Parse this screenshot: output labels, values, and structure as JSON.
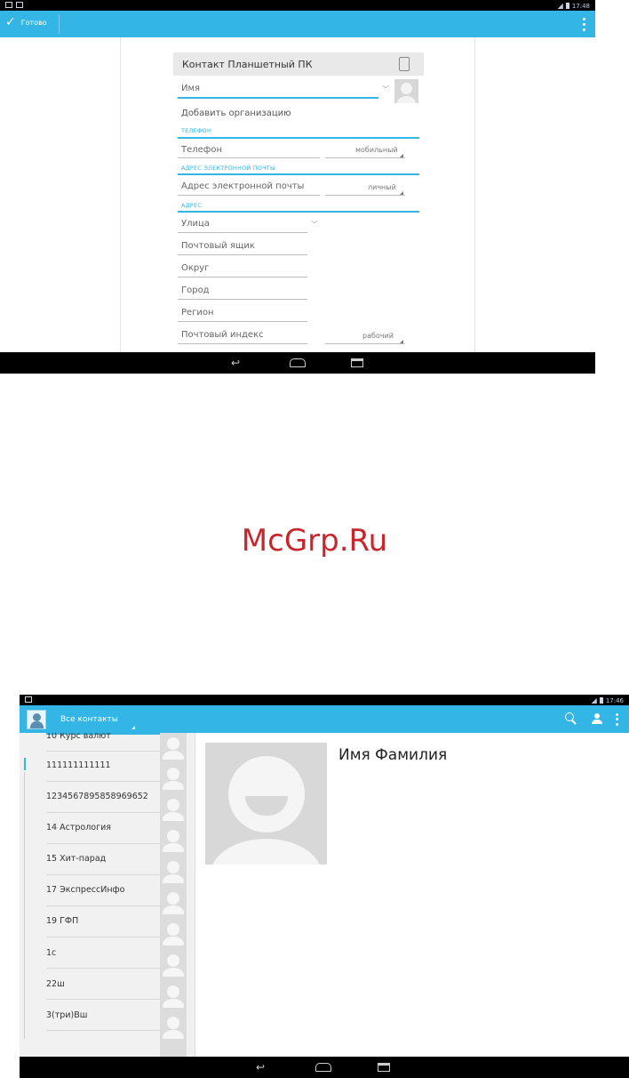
{
  "screen1": {
    "status_time": "17:48",
    "done_label": "Готово",
    "account_label": "Контакт Планшетный ПК",
    "name_placeholder": "Имя",
    "add_org_label": "Добавить организацию",
    "phone_header": "Телефон",
    "phone_placeholder": "Телефон",
    "phone_type": "мобильный",
    "email_header": "Адрес электронной почты",
    "email_placeholder": "Адрес электронной почты",
    "email_type": "личный",
    "address_header": "Адрес",
    "street_placeholder": "Улица",
    "pobox_placeholder": "Почтовый ящик",
    "district_placeholder": "Округ",
    "city_placeholder": "Город",
    "region_placeholder": "Регион",
    "postal_placeholder": "Почтовый индекс",
    "address_type": "рабочий"
  },
  "watermark": "McGrp.Ru",
  "screen2": {
    "status_time": "17:46",
    "filter_label": "Все контакты",
    "contacts": [
      "10 Курс валют",
      "111111111111",
      "1234567895858969652",
      "14 Астрология",
      "15 Хит-парад",
      "17 ЭкспрессИнфо",
      "19 ГФП",
      "1с",
      "22ш",
      "3(три)Вш"
    ],
    "selected_name": "Имя Фамилия"
  },
  "icons": {
    "done": "check-icon",
    "search": "search-icon",
    "add_contact": "person-icon",
    "overflow": "overflow-menu-icon",
    "back": "back-icon",
    "home": "home-icon",
    "recent": "recent-apps-icon"
  },
  "colors": {
    "action_bar": "#33b5e5",
    "accent": "#33b5e5"
  }
}
